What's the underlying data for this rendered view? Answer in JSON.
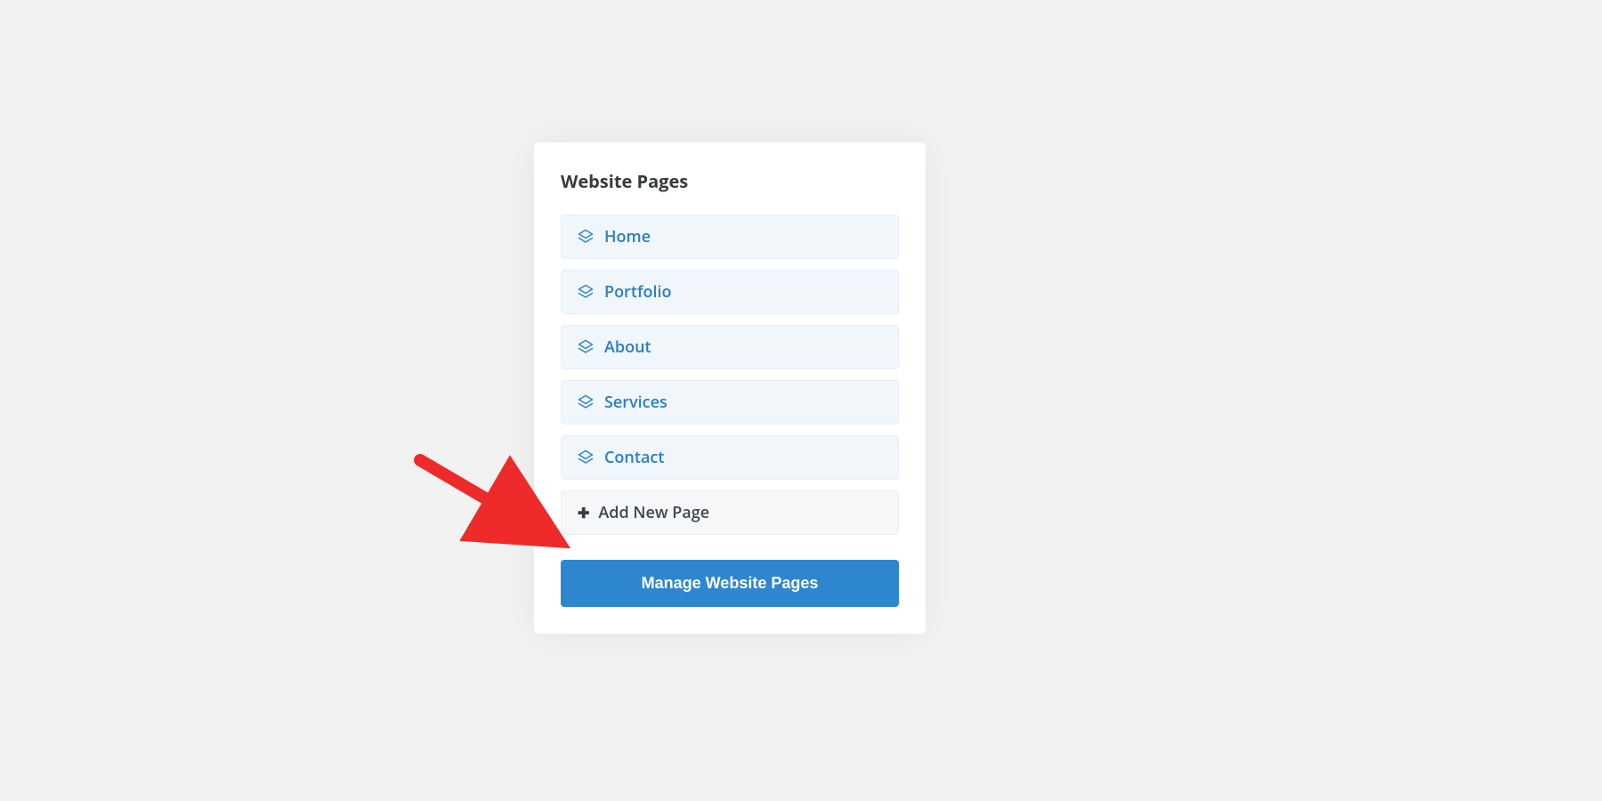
{
  "panel": {
    "title": "Website Pages",
    "pages": [
      {
        "label": "Home"
      },
      {
        "label": "Portfolio"
      },
      {
        "label": "About"
      },
      {
        "label": "Services"
      },
      {
        "label": "Contact"
      }
    ],
    "add_new_label": "Add New Page",
    "manage_button_label": "Manage Website Pages"
  },
  "colors": {
    "accent": "#2e86d1",
    "arrow": "#ee2a2a",
    "text_dark": "#363b3e",
    "link_blue": "#2a7ec6"
  }
}
